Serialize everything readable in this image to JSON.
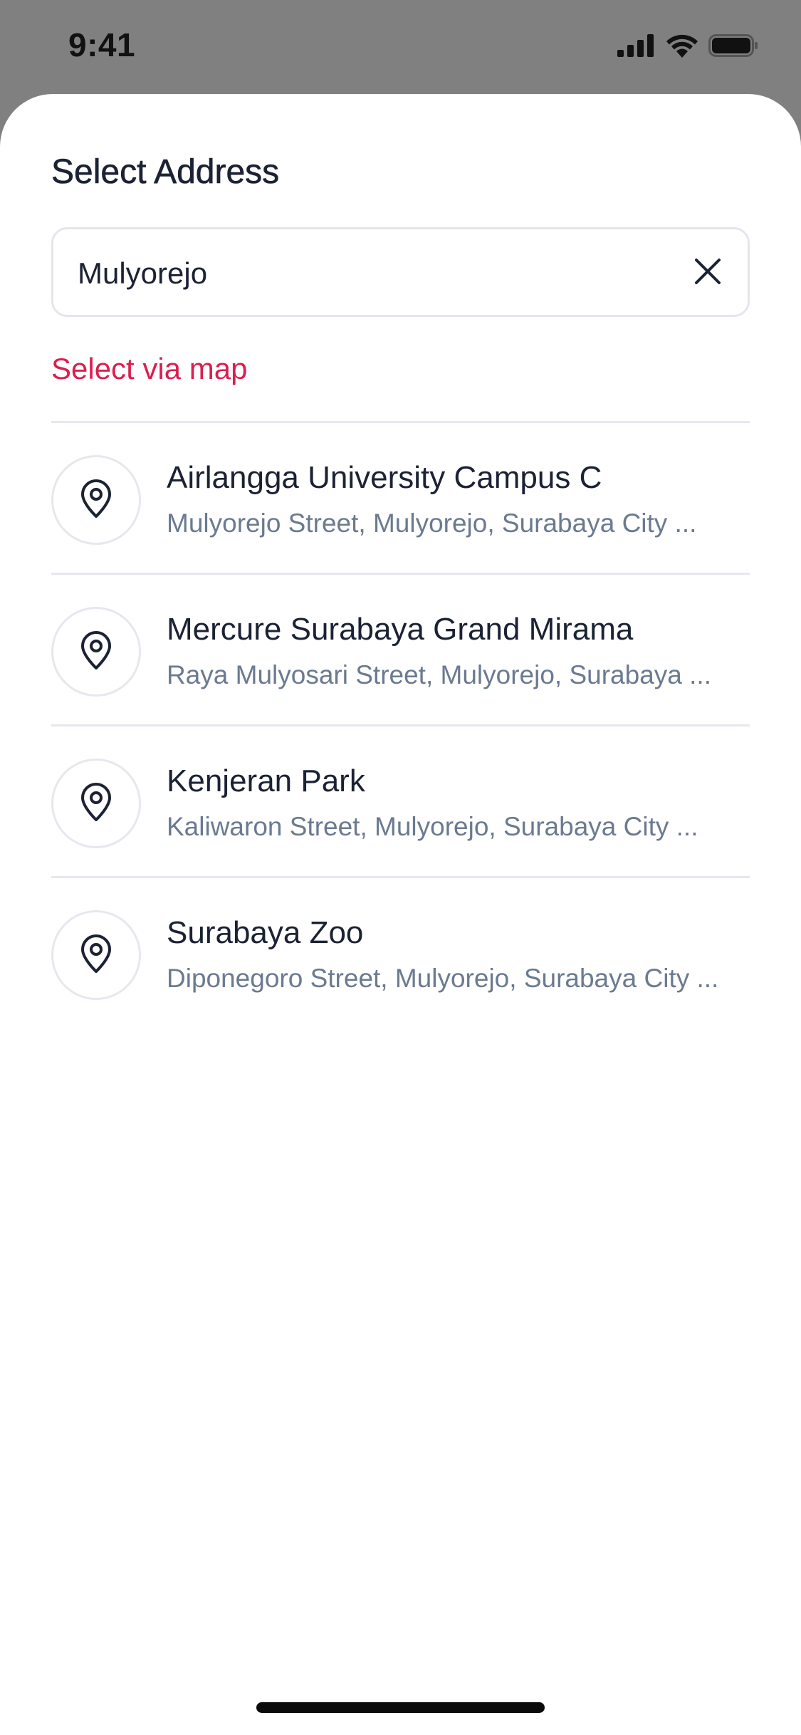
{
  "status_bar": {
    "time": "9:41",
    "icons": [
      "cellular-signal-icon",
      "wifi-icon",
      "battery-icon"
    ]
  },
  "sheet": {
    "title": "Select Address",
    "search": {
      "value": "Mulyorejo",
      "clear_icon": "close-icon"
    },
    "map_link_label": "Select via map",
    "results": [
      {
        "icon": "location-pin-icon",
        "name": "Airlangga University Campus C",
        "address": "Mulyorejo Street, Mulyorejo, Surabaya City ..."
      },
      {
        "icon": "location-pin-icon",
        "name": "Mercure Surabaya Grand Mirama",
        "address": "Raya Mulyosari Street, Mulyorejo, Surabaya ..."
      },
      {
        "icon": "location-pin-icon",
        "name": "Kenjeran Park",
        "address": "Kaliwaron Street, Mulyorejo, Surabaya City ..."
      },
      {
        "icon": "location-pin-icon",
        "name": "Surabaya Zoo",
        "address": "Diponegoro Street, Mulyorejo, Surabaya City ..."
      }
    ]
  },
  "colors": {
    "accent": "#dc1e4f",
    "text_primary": "#1b2233",
    "text_secondary": "#6b7a90",
    "divider": "#e6e8ee",
    "backdrop": "#808080"
  }
}
